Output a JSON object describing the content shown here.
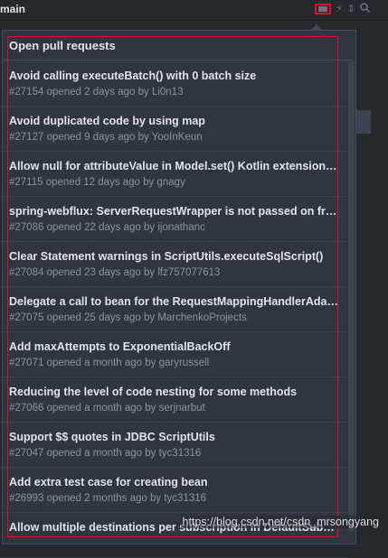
{
  "topbar": {
    "branch": "main"
  },
  "popup": {
    "header": "Open pull requests",
    "items": [
      {
        "title": "Avoid calling executeBatch() with 0 batch size",
        "meta": "#27154 opened 2 days ago by Li0n13"
      },
      {
        "title": "Avoid duplicated code by using map",
        "meta": "#27127 opened 9 days ago by YooInKeun"
      },
      {
        "title": "Allow null for attributeValue in Model.set() Kotlin extension …",
        "meta": "#27115 opened 12 days ago by gnagy"
      },
      {
        "title": "spring-webflux: ServerRequestWrapper is not passed on fro…",
        "meta": "#27086 opened 22 days ago by ijonathanc"
      },
      {
        "title": "Clear Statement warnings in ScriptUtils.executeSqlScript()",
        "meta": "#27084 opened 23 days ago by lfz757077613"
      },
      {
        "title": "Delegate a call to bean for the RequestMappingHandlerAda…",
        "meta": "#27075 opened 25 days ago by MarchenkoProjects"
      },
      {
        "title": "Add maxAttempts to ExponentialBackOff",
        "meta": "#27071 opened a month ago by garyrussell"
      },
      {
        "title": "Reducing the level of code nesting for some methods",
        "meta": "#27066 opened a month ago by serjnarbut"
      },
      {
        "title": "Support $$ quotes in JDBC ScriptUtils",
        "meta": "#27047 opened a month ago by tyc31316"
      },
      {
        "title": "Add extra test case for creating bean",
        "meta": "#26993 opened 2 months ago by tyc31316"
      },
      {
        "title": "Allow multiple destinations per subscription in DefaultSubsc…",
        "meta": ""
      }
    ]
  },
  "watermark": "https://blog.csdn.net/csdn_mrsongyang",
  "colors": {
    "background": "#24292e",
    "popup": "#2f363d",
    "annotation": "#e0102c"
  }
}
